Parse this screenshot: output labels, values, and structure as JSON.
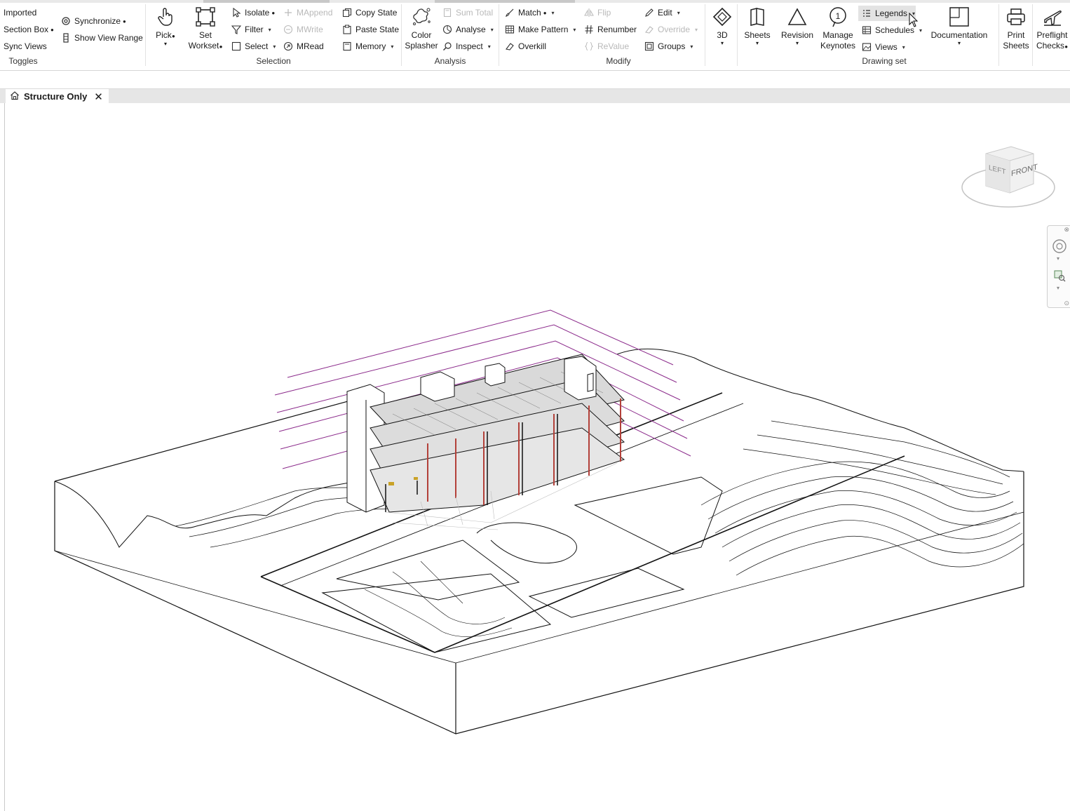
{
  "ribbon": {
    "toggles": {
      "imported": "Imported",
      "section_box": "Section Box",
      "sync_views": "Sync Views",
      "synchronize": "Synchronize",
      "show_view_range": "Show View Range",
      "panel_label": "Toggles"
    },
    "selection": {
      "pick": "Pick",
      "set_workset_1": "Set",
      "set_workset_2": "Workset",
      "isolate": "Isolate",
      "filter": "Filter",
      "select": "Select",
      "mappend": "MAppend",
      "mwrite": "MWrite",
      "mread": "MRead",
      "copy_state": "Copy State",
      "paste_state": "Paste State",
      "memory": "Memory",
      "panel_label": "Selection"
    },
    "analysis": {
      "color_splasher_1": "Color",
      "color_splasher_2": "Splasher",
      "sum_total": "Sum Total",
      "analyse": "Analyse",
      "inspect": "Inspect",
      "panel_label": "Analysis"
    },
    "modify": {
      "match": "Match",
      "make_pattern": "Make Pattern",
      "overkill": "Overkill",
      "flip": "Flip",
      "renumber": "Renumber",
      "revalue": "ReValue",
      "edit": "Edit",
      "override": "Override",
      "groups": "Groups",
      "panel_label": "Modify"
    },
    "drawing_set": {
      "three_d": "3D",
      "sheets": "Sheets",
      "revision": "Revision",
      "manage_keynotes_1": "Manage",
      "manage_keynotes_2": "Keynotes",
      "legends": "Legends",
      "schedules": "Schedules",
      "views": "Views",
      "documentation": "Documentation",
      "panel_label": "Drawing set"
    },
    "print_sheets_1": "Print",
    "print_sheets_2": "Sheets",
    "preflight_1": "Preflight",
    "preflight_2": "Checks"
  },
  "view_tab": {
    "title": "Structure Only"
  },
  "viewcube": {
    "left": "LEFT",
    "front": "FRONT"
  },
  "colors": {
    "accent_line": "#8b2a8b",
    "column_red": "#b3413a",
    "disabled_text": "#b9b9b9"
  }
}
